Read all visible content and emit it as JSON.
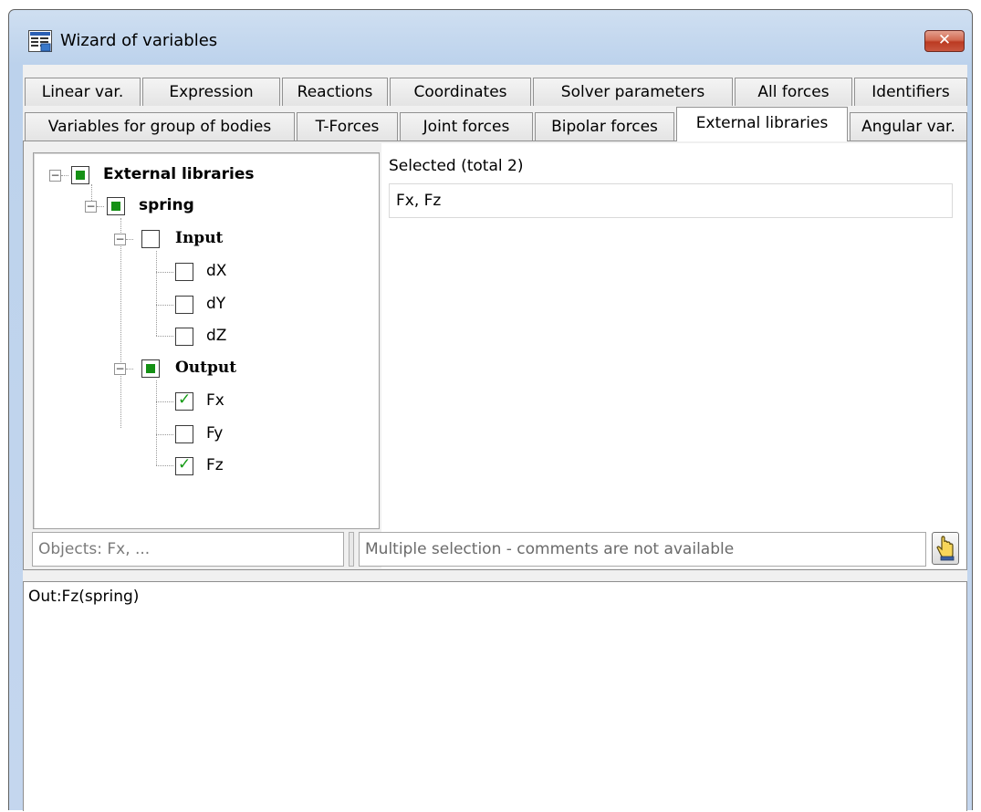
{
  "window": {
    "title": "Wizard of variables",
    "close_label": "✕"
  },
  "tabs": {
    "row1": [
      "Linear var.",
      "Expression",
      "Reactions",
      "Coordinates",
      "Solver parameters",
      "All forces",
      "Identifiers"
    ],
    "row2": [
      "Variables for group of bodies",
      "T-Forces",
      "Joint forces",
      "Bipolar forces",
      "External libraries",
      "Angular var."
    ],
    "active": "External libraries"
  },
  "tree": {
    "root": {
      "label": "External libraries",
      "state": "partial",
      "expanded": true
    },
    "library": {
      "label": "spring",
      "state": "partial",
      "expanded": true
    },
    "input": {
      "label": "Input",
      "state": "unchecked",
      "expanded": true,
      "items": [
        {
          "label": "dX",
          "checked": false
        },
        {
          "label": "dY",
          "checked": false
        },
        {
          "label": "dZ",
          "checked": false
        }
      ]
    },
    "output": {
      "label": "Output",
      "state": "partial",
      "expanded": true,
      "items": [
        {
          "label": "Fx",
          "checked": true
        },
        {
          "label": "Fy",
          "checked": false
        },
        {
          "label": "Fz",
          "checked": true
        }
      ]
    }
  },
  "selected": {
    "label": "Selected (total 2)",
    "value": "Fx, Fz"
  },
  "status": {
    "objects": "Objects: Fx, ...",
    "comment": "Multiple selection - comments are not available"
  },
  "memo": {
    "text": "Out:Fz(spring)"
  },
  "colors": {
    "check_green": "#159015",
    "title_gradient": "#bcd2ec",
    "close_red": "#c8402a"
  },
  "icons": {
    "app": "variables-wizard-icon",
    "hand": "pointing-hand-icon",
    "close": "close-icon"
  }
}
